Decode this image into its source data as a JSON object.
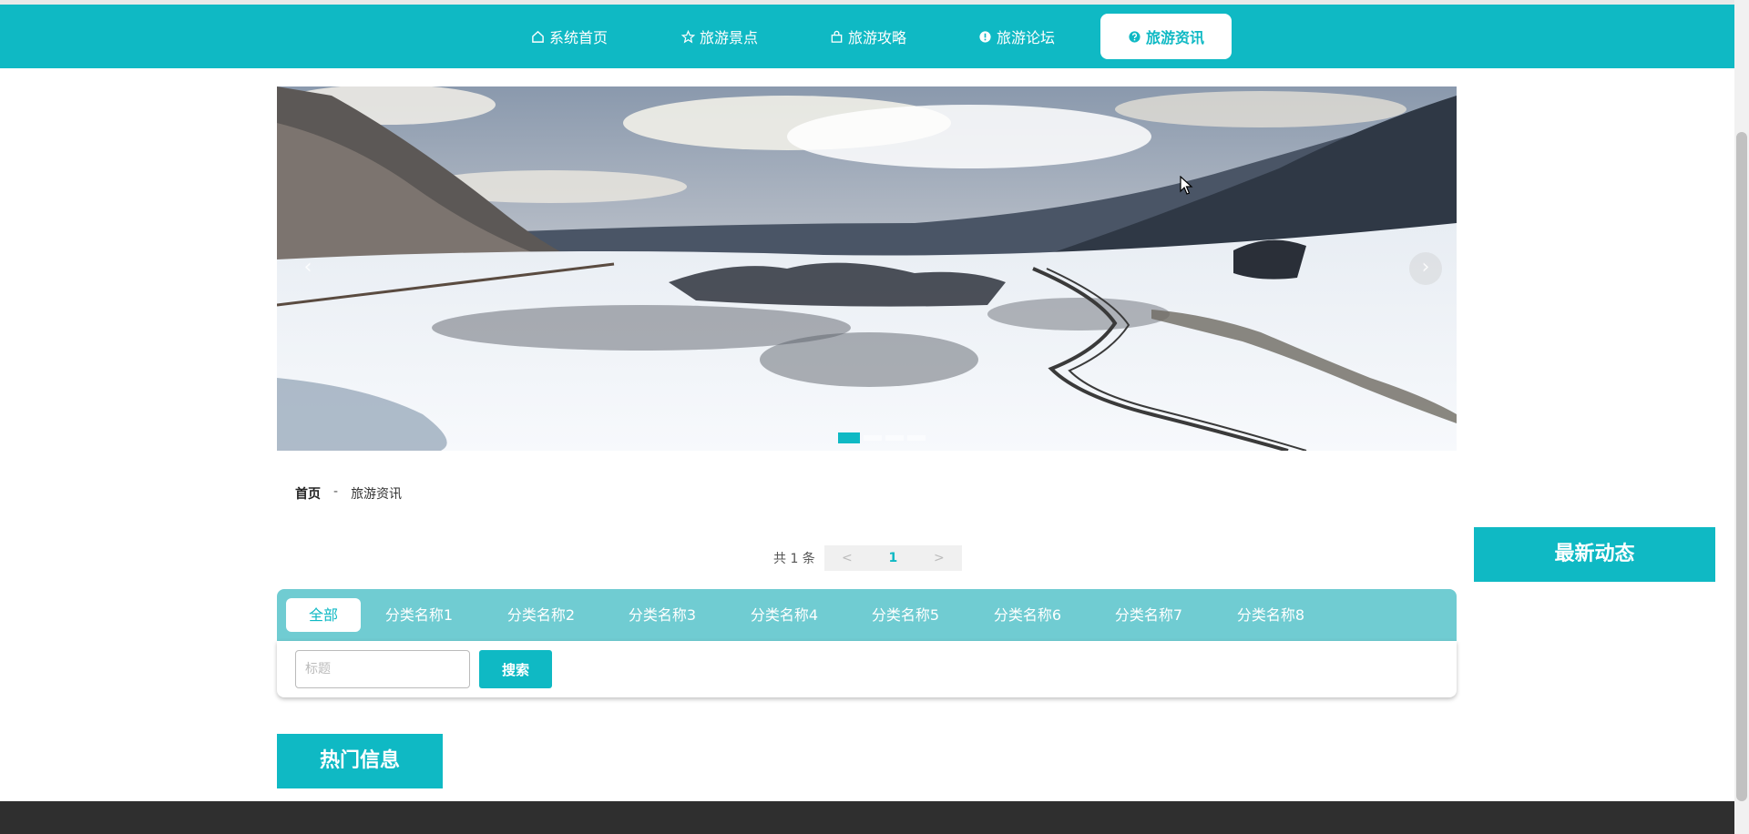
{
  "nav": {
    "items": [
      {
        "label": "系统首页",
        "icon": "home-icon"
      },
      {
        "label": "旅游景点",
        "icon": "star-icon"
      },
      {
        "label": "旅游攻略",
        "icon": "bag-icon"
      },
      {
        "label": "旅游论坛",
        "icon": "info-circle-icon"
      },
      {
        "label": "旅游资讯",
        "icon": "question-circle-icon",
        "active": true
      }
    ]
  },
  "banner": {
    "prev_label": "‹",
    "next_label": "›",
    "slides_count": 4,
    "active_slide": 1
  },
  "breadcrumb": {
    "home": "首页",
    "separator": "-",
    "current": "旅游资讯"
  },
  "pagination": {
    "total": "共 1 条",
    "prev": "<",
    "page": "1",
    "next": ">"
  },
  "categories": {
    "items": [
      "全部",
      "分类名称1",
      "分类名称2",
      "分类名称3",
      "分类名称4",
      "分类名称5",
      "分类名称6",
      "分类名称7",
      "分类名称8"
    ],
    "active_index": 0
  },
  "search": {
    "placeholder": "标题",
    "value": "",
    "button": "搜索"
  },
  "sidebar": {
    "latest_title": "最新动态"
  },
  "hot": {
    "title": "热门信息"
  },
  "colors": {
    "accent": "#0fb9c4",
    "tabs_bg": "#70ccd2",
    "footer": "#2f2f2f"
  }
}
